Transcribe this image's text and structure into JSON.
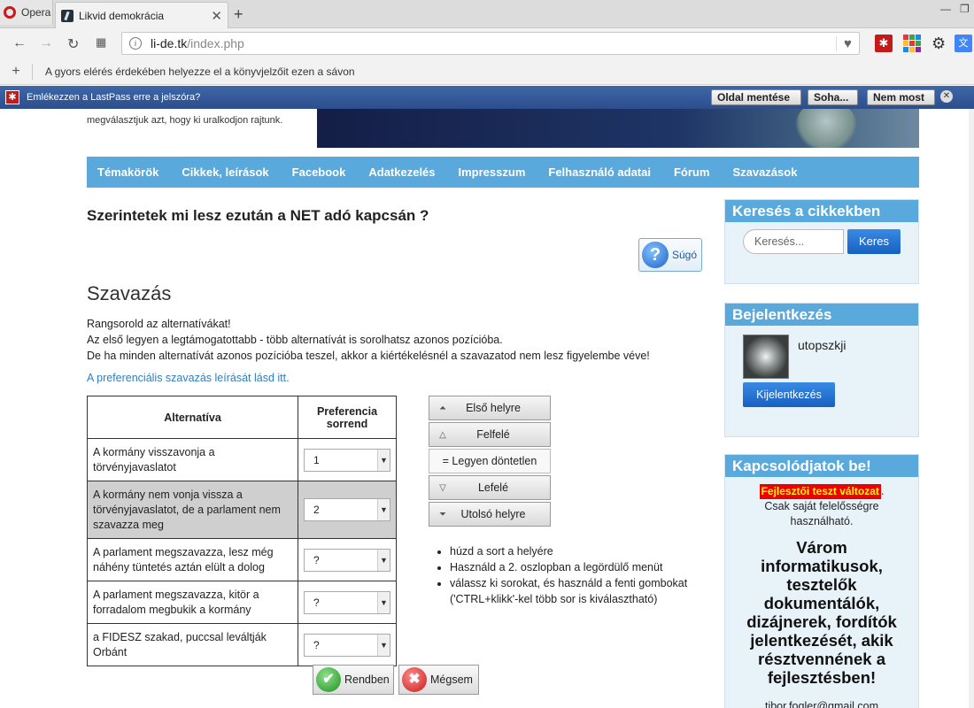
{
  "browser": {
    "menu_label": "Opera",
    "tab_title": "Likvid demokrácia",
    "url_host": "li-de.tk",
    "url_path": "/index.php",
    "bookmarks_hint": "A gyors elérés érdekében helyezze el a könyvjelzőit ezen a sávon",
    "lastpass": {
      "prompt": "Emlékezzen a LastPass erre a jelszóra?",
      "save": "Oldal mentése",
      "never_for": "Soha...",
      "not_now": "Nem most"
    }
  },
  "header": {
    "tagline": "megválasztjuk azt, hogy ki uralkodjon rajtunk."
  },
  "nav": [
    "Témakörök",
    "Cikkek, leírások",
    "Facebook",
    "Adatkezelés",
    "Impresszum",
    "Felhasználó adatai",
    "Fórum",
    "Szavazások"
  ],
  "poll": {
    "question": "Szerintetek mi lesz ezután a NET adó kapcsán ?",
    "help_label": "Súgó",
    "section_title": "Szavazás",
    "instructions": [
      "Rangsorold az alternatívákat!",
      "Az első legyen a legtámogatottabb - több alternatívát is sorolhatsz azonos pozícióba.",
      "De ha minden alternatívát azonos pozícióba teszel, akkor a kiértékelésnél a szavazatod nem lesz figyelembe véve!"
    ],
    "link_text": "A preferenciális szavazás leírását lásd itt.",
    "table": {
      "col_alt": "Alternatíva",
      "col_pref": "Preferencia sorrend",
      "rows": [
        {
          "text": "A kormány visszavonja a törvényjavaslatot",
          "rank": "1",
          "shaded": false
        },
        {
          "text": "A kormány nem vonja vissza a törvényjavaslatot, de a parlament nem szavazza meg",
          "rank": "2",
          "shaded": true
        },
        {
          "text": "A parlament megszavazza, lesz még náhény tüntetés aztán elült a dolog",
          "rank": "?",
          "shaded": false
        },
        {
          "text": "A parlament megszavazza, kitör a forradalom megbukik a kormány",
          "rank": "?",
          "shaded": false
        },
        {
          "text": "a FIDESZ szakad, puccsal leváltják Orbánt",
          "rank": "?",
          "shaded": false
        }
      ]
    },
    "actions": {
      "first": "Első helyre",
      "up": "Felfelé",
      "tie": "= Legyen döntetlen",
      "down": "Lefelé",
      "last": "Utolsó helyre"
    },
    "tips": [
      "húzd a sort a helyére",
      "Használd a 2. oszlopban a legördülő menüt",
      "válassz ki sorokat, és használd a fenti gombokat ('CTRL+klikk'-kel több sor is kiválasztható)"
    ],
    "ok_label": "Rendben",
    "cancel_label": "Mégsem"
  },
  "sidebar": {
    "search": {
      "title": "Keresés a cikkekben",
      "placeholder": "Keresés...",
      "button": "Keres"
    },
    "login": {
      "title": "Bejelentkezés",
      "username": "utopszkji",
      "button": "Kijelentkezés"
    },
    "join": {
      "title": "Kapcsolódjatok be!",
      "badge": "Fejlesztői teszt változat",
      "note": "Csak saját felelősségre használható.",
      "call": "Várom informatikusok, tesztelők dokumentálók, dizájnerek, fordítók jelentkezését, akik résztvennének a fejlesztésben!",
      "email": "tibor.fogler@gmail.com"
    }
  }
}
